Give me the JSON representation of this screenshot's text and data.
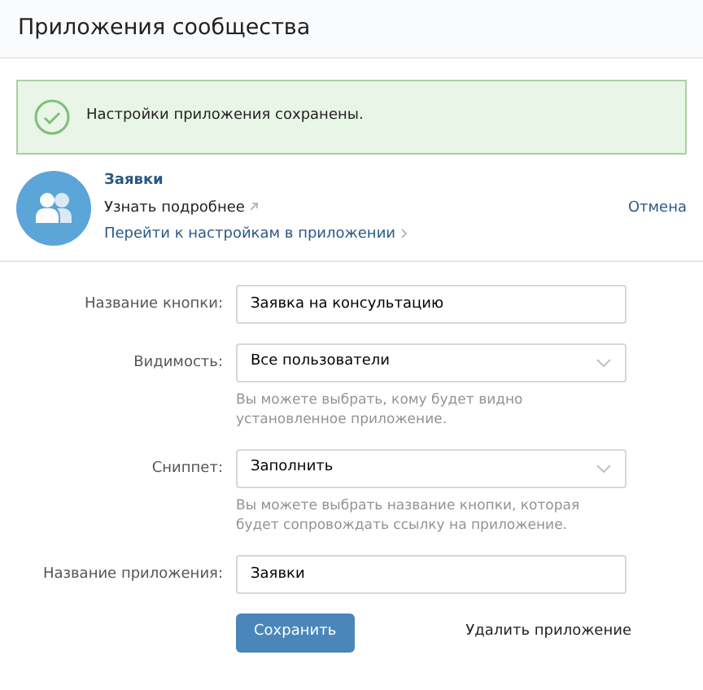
{
  "header": {
    "title": "Приложения сообщества"
  },
  "alert": {
    "text": "Настройки приложения сохранены."
  },
  "app": {
    "name": "Заявки",
    "learn_more": "Узнать подробнее",
    "settings_link": "Перейти к настройкам в приложении",
    "cancel": "Отмена"
  },
  "form": [
    {
      "kind": "text",
      "label": "Название кнопки:",
      "value": "Заявка на консультацию"
    },
    {
      "kind": "select",
      "label": "Видимость:",
      "value": "Все пользователи",
      "hint": "Вы можете выбрать, кому будет видно установленное приложение."
    },
    {
      "kind": "select",
      "label": "Сниппет:",
      "value": "Заполнить",
      "hint": "Вы можете выбрать название кнопки, которая будет сопровождать ссылку на приложение."
    },
    {
      "kind": "text",
      "label": "Название приложения:",
      "value": "Заявки"
    }
  ],
  "buttons": {
    "save": "Сохранить",
    "delete": "Удалить приложение"
  }
}
